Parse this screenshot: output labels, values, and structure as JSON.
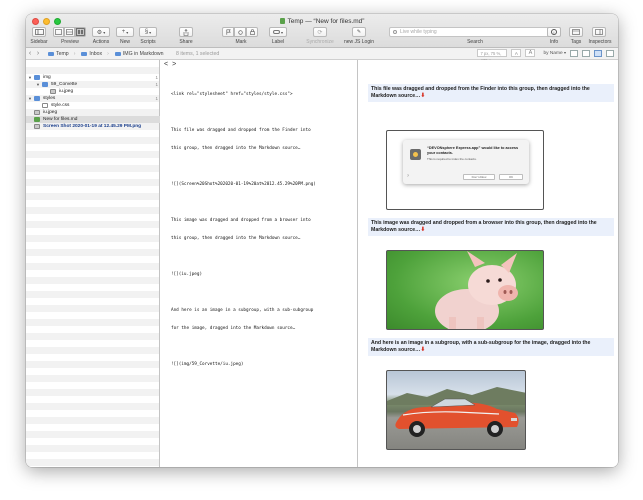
{
  "window": {
    "title": "Temp — “New for files.md”"
  },
  "toolbar": {
    "sidebar": "Sidebar",
    "preview": "Preview",
    "actions": "Actions",
    "new": "New",
    "scripts": "Scripts",
    "share": "Share",
    "mark": "Mark",
    "label": "Label",
    "synchronize": "Synchronize",
    "new_js_login": "new JS Login",
    "search": "Search",
    "search_placeholder": "Live while typing",
    "info": "Info",
    "tags": "Tags",
    "inspectors": "Inspectors"
  },
  "pathbar": {
    "crumbs": [
      "Temp",
      "Inbox",
      "IMG in Markdown"
    ],
    "items_status": "8 items, 1 selected",
    "zoom": "7 px, 75 %, 470 ×",
    "font_a_small": "A",
    "font_a_large": "A",
    "sort": "by Name"
  },
  "sidebar": {
    "items": [
      {
        "name": "img",
        "count": "1"
      },
      {
        "name": "59_Corvette",
        "count": "1"
      },
      {
        "name": "iu.jpeg",
        "count": ""
      },
      {
        "name": "styles",
        "count": "1"
      },
      {
        "name": "style.css",
        "count": ""
      },
      {
        "name": "iu.jpeg",
        "count": ""
      },
      {
        "name": "New for files.md",
        "count": ""
      },
      {
        "name": "Screen Shot 2020-01-19 at 12.45.29 PM.png",
        "count": ""
      }
    ]
  },
  "editor": {
    "back": "<",
    "forward": ">",
    "lines": [
      "<link rel=\"stylesheet\" href=\"styles/style.css\">",
      "",
      "This file was dragged and dropped from the Finder into",
      "this group, then dragged into the Markdown source…",
      "",
      "![](Screen%20Shot%202020-01-19%20at%2012.45.29%20PM.png)",
      "",
      "This image was dragged and dropped from a browser into",
      "this group, then dragged into the Markdown source…",
      "",
      "![](iu.jpeg)",
      "",
      "And here is an image in a subgroup, with a sub-subgroup",
      "for the image, dragged into the Markdown source…",
      "",
      "![](img/59_Corvette/iu.jpeg)"
    ]
  },
  "preview": {
    "para1": "This file was dragged and dropped from the Finder into this group, then dragged into the Markdown source…",
    "para2": "This image was dragged and dropped from a browser into this group, then dragged into the Markdown source…",
    "para3": "And here is an image in a subgroup, with a sub-subgroup for the image, dragged into the Markdown source…",
    "arrow": "⬇",
    "dialog": {
      "title": "“DEVONsphere Express.app” would like to access your contacts.",
      "subtitle": "This is required to index the contacts.",
      "question": "?",
      "dont_allow": "Don't Allow",
      "ok": "OK"
    }
  },
  "colors": {
    "accent_blue": "#1a3e8c",
    "para_bg": "#eaf0fb",
    "arrow_red": "#d62c1f",
    "folder_blue": "#5a8fd8",
    "md_green": "#5aa14a"
  }
}
